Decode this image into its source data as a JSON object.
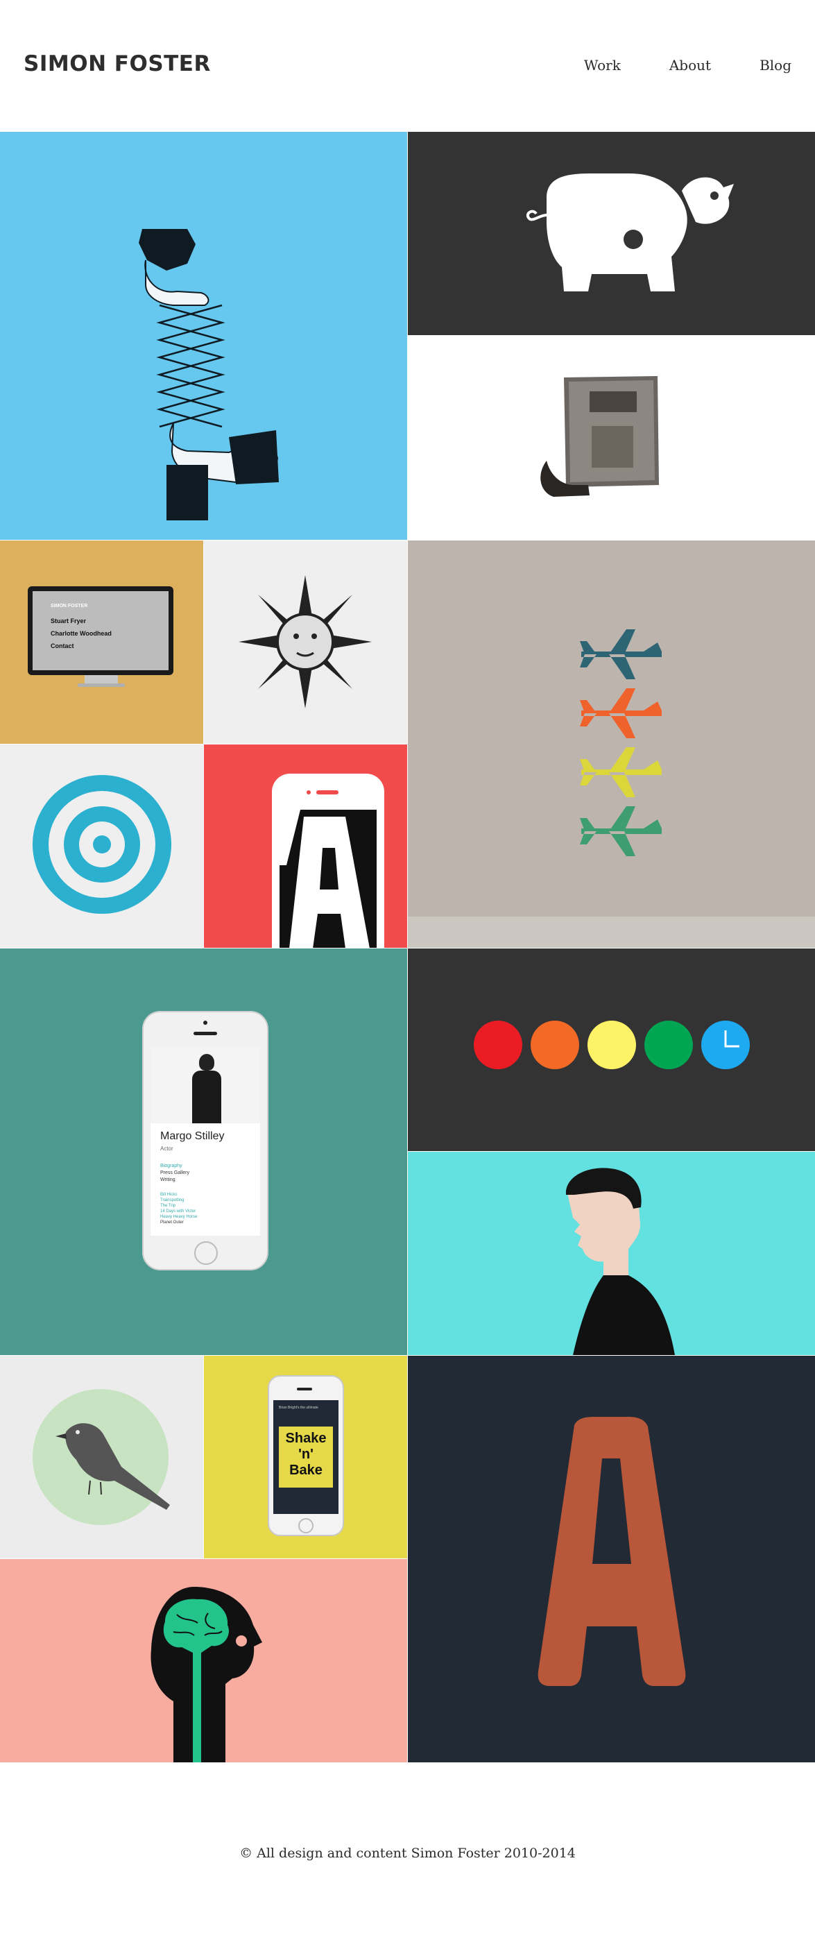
{
  "site": {
    "title": "SIMON FOSTER"
  },
  "nav": [
    {
      "label": "Work"
    },
    {
      "label": "About"
    },
    {
      "label": "Blog"
    }
  ],
  "screens": {
    "monitor": {
      "heading": "SIMON FOSTER",
      "items": [
        "Stuart Fryer",
        "Charlotte Woodhead",
        "Contact"
      ]
    },
    "phone_profile": {
      "name": "Margo Stilley",
      "role": "Actor",
      "links": [
        "Biography",
        "Press Gallery",
        "Writing"
      ],
      "credits": [
        "Bill Hicks",
        "Trainspotting",
        "The Trip",
        "14 Days with Victor",
        "Heavy Heavy Horse",
        "Planet Outer"
      ]
    },
    "phone_shake": {
      "topline": "Brian Bright's the ultimate",
      "line1": "Shake",
      "line2": "'n'",
      "line3": "Bake"
    },
    "letter_a": "A"
  },
  "colors": {
    "sky": "#66c8ef",
    "charcoal": "#333333",
    "mustard": "#dcb05c",
    "paper": "#efefef",
    "taupe": "#bdb5ad",
    "coral": "#f24b4b",
    "teal": "#4c9a8f",
    "aqua": "#63e0e0",
    "yellow": "#e5d94a",
    "pink": "#f8aca0",
    "navy": "#212a35",
    "rust": "#b9573b",
    "dots": [
      "#ec1c24",
      "#f26a25",
      "#fef366",
      "#00a651",
      "#1eaaf1"
    ]
  },
  "footer": {
    "text": "© All design and content Simon Foster 2010-2014"
  }
}
